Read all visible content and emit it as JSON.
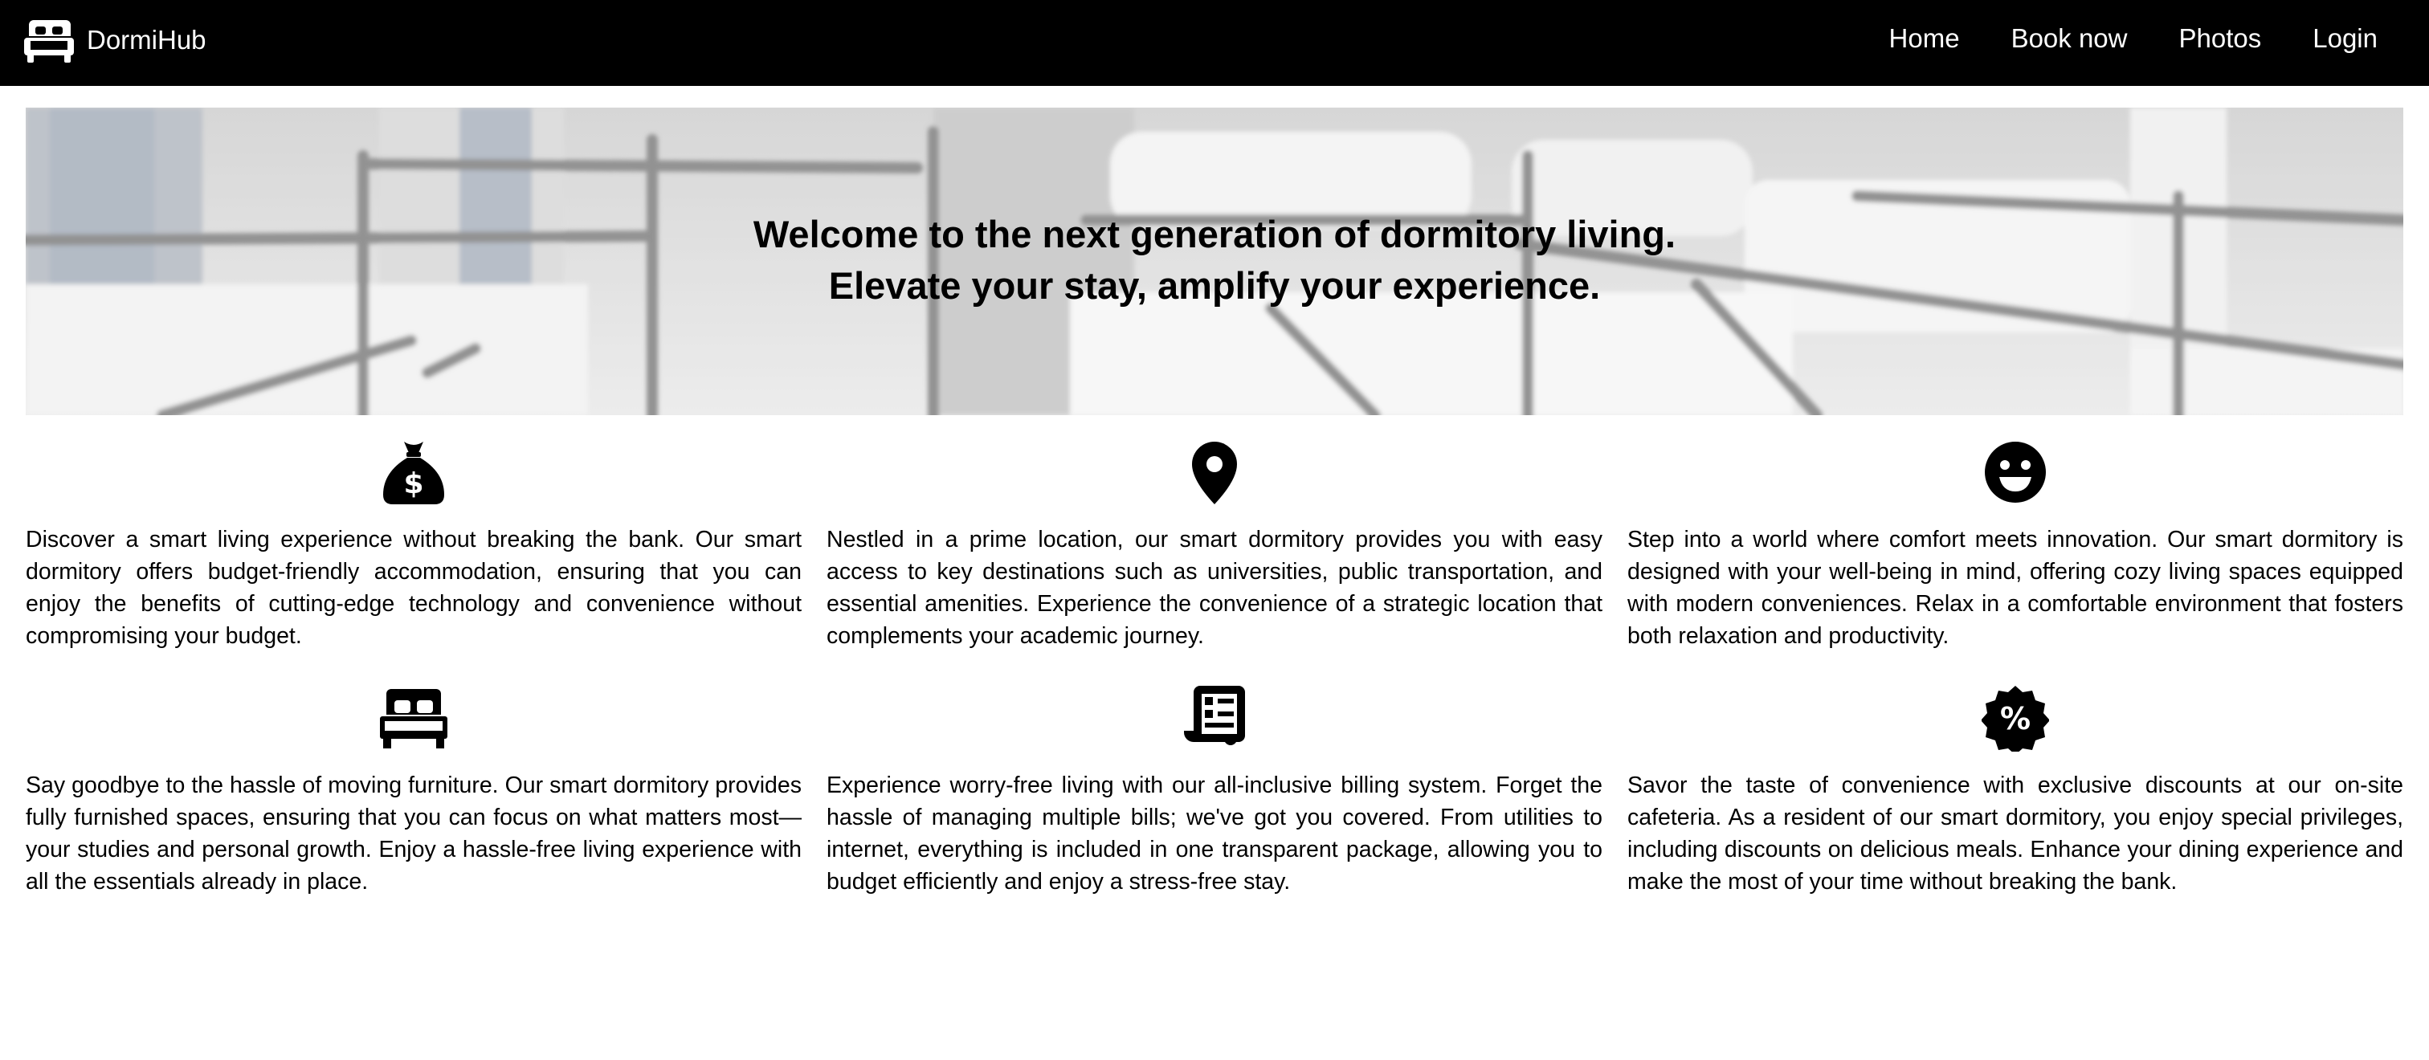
{
  "navbar": {
    "brand_icon": "bed-icon",
    "brand_name": "DormiHub",
    "links": [
      {
        "label": "Home"
      },
      {
        "label": "Book now"
      },
      {
        "label": "Photos"
      },
      {
        "label": "Login"
      }
    ]
  },
  "hero": {
    "line1": "Welcome to the next generation of dormitory living.",
    "line2": "Elevate your stay, amplify your experience."
  },
  "features": [
    {
      "icon": "money-bag-icon",
      "text": "Discover a smart living experience without breaking the bank. Our smart dormitory offers budget-friendly accommodation, ensuring that you can enjoy the benefits of cutting-edge technology and convenience without compromising your budget."
    },
    {
      "icon": "location-pin-icon",
      "text": "Nestled in a prime location, our smart dormitory provides you with easy access to key destinations such as universities, public transportation, and essential amenities. Experience the convenience of a strategic location that complements your academic journey."
    },
    {
      "icon": "smiley-face-icon",
      "text": "Step into a world where comfort meets innovation. Our smart dormitory is designed with your well-being in mind, offering cozy living spaces equipped with modern conveniences. Relax in a comfortable environment that fosters both relaxation and productivity."
    },
    {
      "icon": "bed-icon",
      "text": "Say goodbye to the hassle of moving furniture. Our smart dormitory provides fully furnished spaces, ensuring that you can focus on what matters most—your studies and personal growth. Enjoy a hassle-free living experience with all the essentials already in place."
    },
    {
      "icon": "receipt-icon",
      "text": "Experience worry-free living with our all-inclusive billing system. Forget the hassle of managing multiple bills; we've got you covered. From utilities to internet, everything is included in one transparent package, allowing you to budget efficiently and enjoy a stress-free stay."
    },
    {
      "icon": "discount-badge-icon",
      "text": "Savor the taste of convenience with exclusive discounts at our on-site cafeteria. As a resident of our smart dormitory, you enjoy special privileges, including discounts on delicious meals. Enhance your dining experience and make the most of your time without breaking the bank."
    }
  ]
}
